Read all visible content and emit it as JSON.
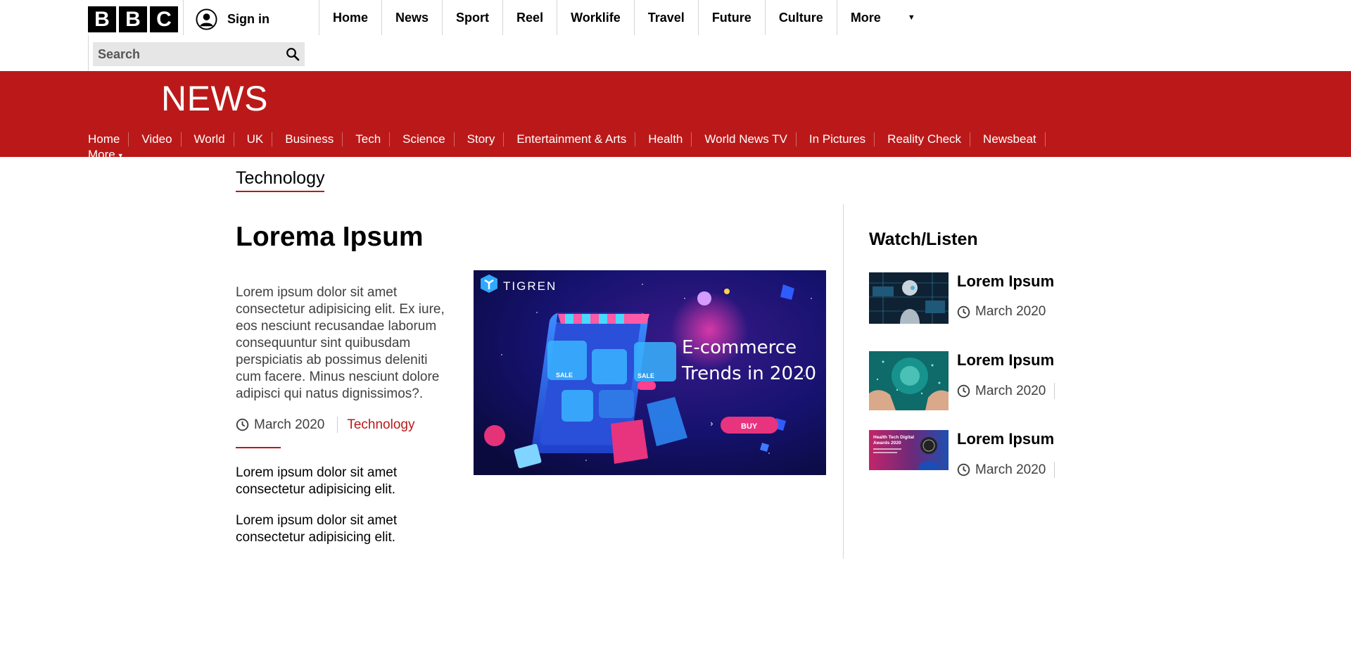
{
  "topbar": {
    "logo_letters": [
      "B",
      "B",
      "C"
    ],
    "sign_in": "Sign in",
    "search_placeholder": "Search",
    "nav": [
      "Home",
      "News",
      "Sport",
      "Reel",
      "Worklife",
      "Travel",
      "Future",
      "Culture",
      "More"
    ]
  },
  "news": {
    "title": "NEWS",
    "subnav": [
      "Home",
      "Video",
      "World",
      "UK",
      "Business",
      "Tech",
      "Science",
      "Story",
      "Entertainment & Arts",
      "Health",
      "World News TV",
      "In Pictures",
      "Reality Check",
      "Newsbeat"
    ],
    "more": "More"
  },
  "section": {
    "heading": "Technology"
  },
  "main_story": {
    "headline": "Lorema Ipsum",
    "summary": "Lorem ipsum dolor sit amet consectetur adipisicing elit. Ex iure, eos nesciunt recusandae laborum consequuntur sint quibusdam perspiciatis ab possimus deleniti cum facere. Minus nesciunt dolore adipisci qui natus dignissimos?.",
    "date": "March 2020",
    "topic": "Technology",
    "related": [
      "Lorem ipsum dolor sit amet consectetur adipisicing elit.",
      "Lorem ipsum dolor sit amet consectetur adipisicing elit."
    ],
    "image": {
      "brand": "TIGREN",
      "line1": "E-commerce",
      "line2": "Trends in 2020",
      "sale1": "SALE",
      "sale2": "SALE",
      "buy": "BUY"
    }
  },
  "watch_listen": {
    "title": "Watch/Listen",
    "items": [
      {
        "headline": "Lorem Ipsum",
        "date": "March 2020"
      },
      {
        "headline": "Lorem Ipsum",
        "date": "March 2020"
      },
      {
        "headline": "Lorem Ipsum",
        "date": "March 2020",
        "thumb_caption": "Health Tech Digital Awards 2020"
      }
    ]
  }
}
